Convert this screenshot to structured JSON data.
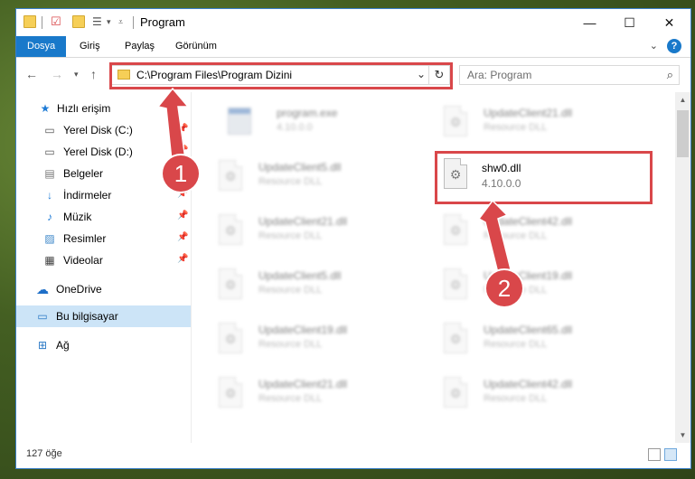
{
  "window": {
    "title": "Program",
    "controls": {
      "minimize": "—",
      "maximize": "☐",
      "close": "✕"
    }
  },
  "ribbon": {
    "tabs": [
      "Dosya",
      "Giriş",
      "Paylaş",
      "Görünüm"
    ],
    "help": "?"
  },
  "navigation": {
    "address": "C:\\Program Files\\Program Dizini",
    "search_placeholder": "Ara: Program"
  },
  "sidebar": {
    "quick_access": "Hızlı erişim",
    "items": [
      {
        "label": "Yerel Disk (C:)",
        "icon": "drive-icon",
        "pinned": true
      },
      {
        "label": "Yerel Disk (D:)",
        "icon": "drive-icon",
        "pinned": true
      },
      {
        "label": "Belgeler",
        "icon": "documents-icon",
        "pinned": true
      },
      {
        "label": "İndirmeler",
        "icon": "download-icon",
        "pinned": true
      },
      {
        "label": "Müzik",
        "icon": "music-icon",
        "pinned": true
      },
      {
        "label": "Resimler",
        "icon": "pictures-icon",
        "pinned": true
      },
      {
        "label": "Videolar",
        "icon": "videos-icon",
        "pinned": true
      }
    ],
    "onedrive": "OneDrive",
    "this_pc": "Bu bilgisayar",
    "network": "Ağ"
  },
  "files": {
    "left": [
      {
        "name": "program.exe",
        "sub": "4.10.0.0",
        "type": "exe"
      },
      {
        "name": "UpdateClient5.dll",
        "sub": "Resource DLL",
        "type": "dll"
      },
      {
        "name": "UpdateClient21.dll",
        "sub": "Resource DLL",
        "type": "dll"
      },
      {
        "name": "UpdateClient5.dll",
        "sub": "Resource DLL",
        "type": "dll"
      },
      {
        "name": "UpdateClient19.dll",
        "sub": "Resource DLL",
        "type": "dll"
      },
      {
        "name": "UpdateClient21.dll",
        "sub": "Resource DLL",
        "type": "dll"
      }
    ],
    "right": [
      {
        "name": "UpdateClient21.dll",
        "sub": "Resource DLL",
        "type": "dll"
      },
      {
        "name": "shw0.dll",
        "sub": "4.10.0.0",
        "type": "dll",
        "highlight": true
      },
      {
        "name": "UpdateClient42.dll",
        "sub": "Resource DLL",
        "type": "dll"
      },
      {
        "name": "UpdateClient19.dll",
        "sub": "Resource DLL",
        "type": "dll"
      },
      {
        "name": "UpdateClient65.dll",
        "sub": "Resource DLL",
        "type": "dll"
      },
      {
        "name": "UpdateClient42.dll",
        "sub": "Resource DLL",
        "type": "dll"
      }
    ]
  },
  "status": {
    "count": "127 öğe"
  },
  "markers": [
    "1",
    "2"
  ],
  "accent_color": "#d9474a"
}
